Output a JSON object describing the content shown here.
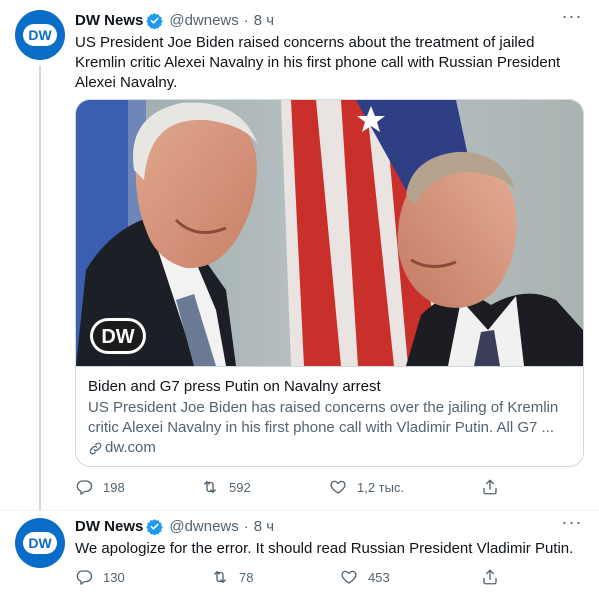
{
  "colors": {
    "accent": "#1d9bf0",
    "dw_blue": "#0a6ec9",
    "secondary_text": "#536471",
    "border": "#cfd9de"
  },
  "tweets": [
    {
      "author_name": "DW News",
      "handle": "@dwnews",
      "separator": "·",
      "time": "8 ч",
      "avatar_logo_text": "DW",
      "text": "US President Joe Biden raised concerns about the treatment of jailed Kremlin critic Alexei Navalny in his first phone call with Russian President Alexei Navalny.",
      "card": {
        "image_watermark": "DW",
        "title": "Biden and G7 press Putin on Navalny arrest",
        "description": "US President Joe Biden has raised concerns over the jailing of Kremlin critic Alexei Navalny in his first phone call with Vladimir Putin. All G7 ...",
        "domain": "dw.com"
      },
      "stats": {
        "replies": "198",
        "retweets": "592",
        "likes": "1,2 тыс."
      },
      "icons": [
        "verified-badge-icon",
        "more-icon",
        "link-icon",
        "reply-icon",
        "retweet-icon",
        "like-icon",
        "share-icon"
      ]
    },
    {
      "author_name": "DW News",
      "handle": "@dwnews",
      "separator": "·",
      "time": "8 ч",
      "avatar_logo_text": "DW",
      "text": "We apologize for the error. It should read Russian President Vladimir Putin.",
      "stats": {
        "replies": "130",
        "retweets": "78",
        "likes": "453"
      },
      "icons": [
        "verified-badge-icon",
        "more-icon",
        "reply-icon",
        "retweet-icon",
        "like-icon",
        "share-icon"
      ]
    }
  ]
}
